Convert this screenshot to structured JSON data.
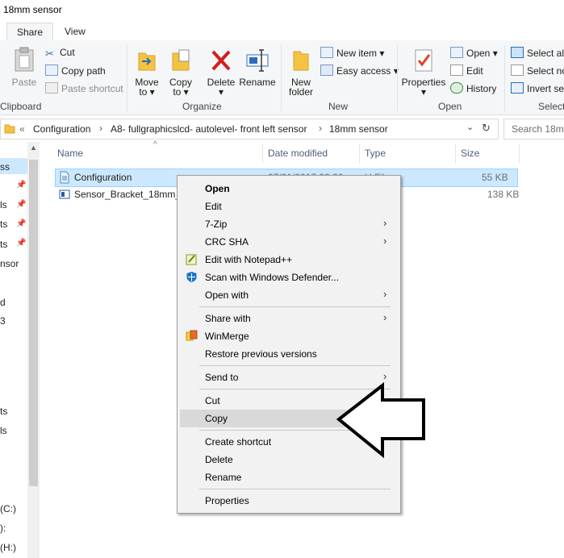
{
  "window": {
    "title": "18mm sensor"
  },
  "tabs": [
    {
      "label": "Share"
    },
    {
      "label": "View"
    }
  ],
  "ribbon": {
    "clipboard": {
      "paste": "Paste",
      "cut": "Cut",
      "copy_path": "Copy path",
      "paste_shortcut": "Paste shortcut",
      "group": "Clipboard"
    },
    "organize": {
      "move_to_l1": "Move",
      "move_to_l2": "to ▾",
      "copy_to_l1": "Copy",
      "copy_to_l2": "to ▾",
      "delete_l1": "Delete",
      "delete_l2": "▾",
      "rename": "Rename",
      "group": "Organize"
    },
    "new": {
      "new_folder_l1": "New",
      "new_folder_l2": "folder",
      "new_item": "New item ▾",
      "easy_access": "Easy access ▾",
      "group": "New"
    },
    "open": {
      "properties_l1": "Properties",
      "properties_l2": "▾",
      "open": "Open ▾",
      "edit": "Edit",
      "history": "History",
      "group": "Open"
    },
    "select": {
      "select_all": "Select all",
      "select_none": "Select no",
      "invert": "Invert sel",
      "group": "Select"
    }
  },
  "address": {
    "overflow": "«",
    "crumbs": [
      "Configuration",
      "A8- fullgraphicslcd- autolevel- front left sensor",
      "18mm sensor"
    ],
    "search_placeholder": "Search 18m"
  },
  "nav": [
    "ss",
    "ls",
    "ts",
    "ts",
    "nsor",
    "d",
    "3",
    "ts",
    "ls",
    "(C:)",
    "):",
    "(H:)"
  ],
  "columns": {
    "name": "Name",
    "date": "Date modified",
    "type": "Type",
    "size": "Size"
  },
  "files": [
    {
      "name": "Configuration",
      "date": "07/01/2017 22:30",
      "type": "H File",
      "size": "55 KB"
    },
    {
      "name": "Sensor_Bracket_18mm_L",
      "date": "",
      "type": "",
      "size": "138 KB"
    }
  ],
  "context_menu": {
    "open": "Open",
    "edit": "Edit",
    "seven_zip": "7-Zip",
    "crc_sha": "CRC SHA",
    "notepadpp": "Edit with Notepad++",
    "defender": "Scan with Windows Defender...",
    "open_with": "Open with",
    "share_with": "Share with",
    "winmerge": "WinMerge",
    "restore": "Restore previous versions",
    "send_to": "Send to",
    "cut": "Cut",
    "copy": "Copy",
    "create_shortcut": "Create shortcut",
    "delete": "Delete",
    "rename": "Rename",
    "properties": "Properties",
    "submenu_glyph": "›"
  }
}
